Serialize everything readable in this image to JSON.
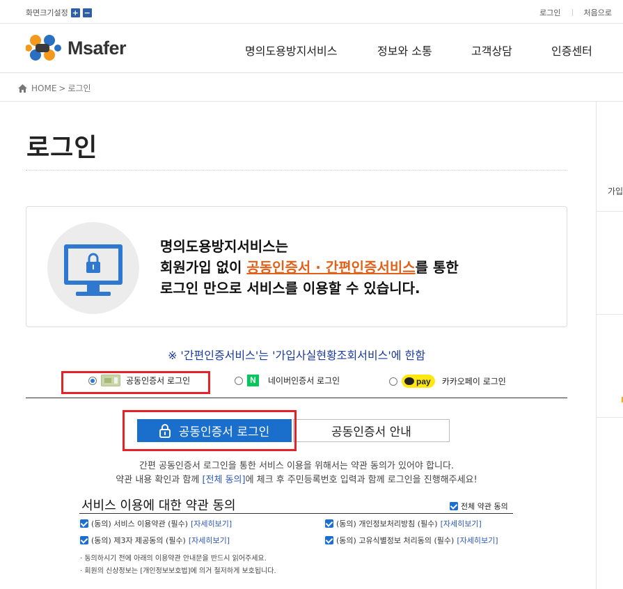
{
  "topbar": {
    "screen_size_label": "화면크기설정",
    "zoom_in": "+",
    "zoom_out": "−",
    "login": "로그인",
    "home": "처음으로"
  },
  "header": {
    "logo_text": "Msafer",
    "nav": [
      "명의도용방지서비스",
      "정보와 소통",
      "고객상담",
      "인증센터"
    ]
  },
  "breadcrumb": {
    "home": "HOME",
    "sep": ">",
    "current": "로그인"
  },
  "side": {
    "label": "가입"
  },
  "page": {
    "title": "로그인",
    "info": {
      "line1": "명의도용방지서비스는",
      "line2_pre": "회원가입 없이 ",
      "line2_highlight": "공동인증서 · 간편인증서비스",
      "line2_post": "를 통한",
      "line3": "로그인 만으로 서비스를 이용할 수 있습니다."
    },
    "notice": "※ '간편인증서비스'는 '가입사실현황조회서비스'에 한함",
    "login_options": [
      {
        "label": "공동인증서 로그인",
        "selected": true
      },
      {
        "label": "네이버인증서 로그인",
        "badge": "N",
        "selected": false
      },
      {
        "label": "카카오페이 로그인",
        "badge": "pay",
        "selected": false
      }
    ],
    "login_button": "공동인증서  로그인",
    "guide_button": "공동인증서  안내",
    "desc_line1": "간편 공동인증서 로그인을 통한 서비스 이용을 위해서는 약관 동의가 있어야 합니다.",
    "desc_line2_pre": "약관 내용 확인과 함께 ",
    "desc_line2_link": "[전체 동의]",
    "desc_line2_post": "에 체크 후 주민등록번호 입력과 함께 로그인을 진행해주세요!",
    "terms": {
      "title": "서비스 이용에 대한 약관 동의",
      "all_label": "전체 약관 동의",
      "detail_label": "[자세히보기]",
      "items": [
        "(동의) 서비스 이용약관 (필수)",
        "(동의) 개인정보처리방침 (필수)",
        "(동의) 제3자 제공동의 (필수)",
        "(동의) 고유식별정보 처리동의 (필수)"
      ],
      "notes": [
        "· 동의하시기 전에 아래의 이용약관 안내문을 반드시 읽어주세요.",
        "· 회원의 신상정보는 [개인정보보호법]에 의거 철저하게 보호됩니다."
      ]
    }
  },
  "colors": {
    "primary_blue": "#1b6fcc",
    "highlight_orange": "#e2611a",
    "notice_blue": "#1a3a9c",
    "red_frame": "#e52228"
  }
}
